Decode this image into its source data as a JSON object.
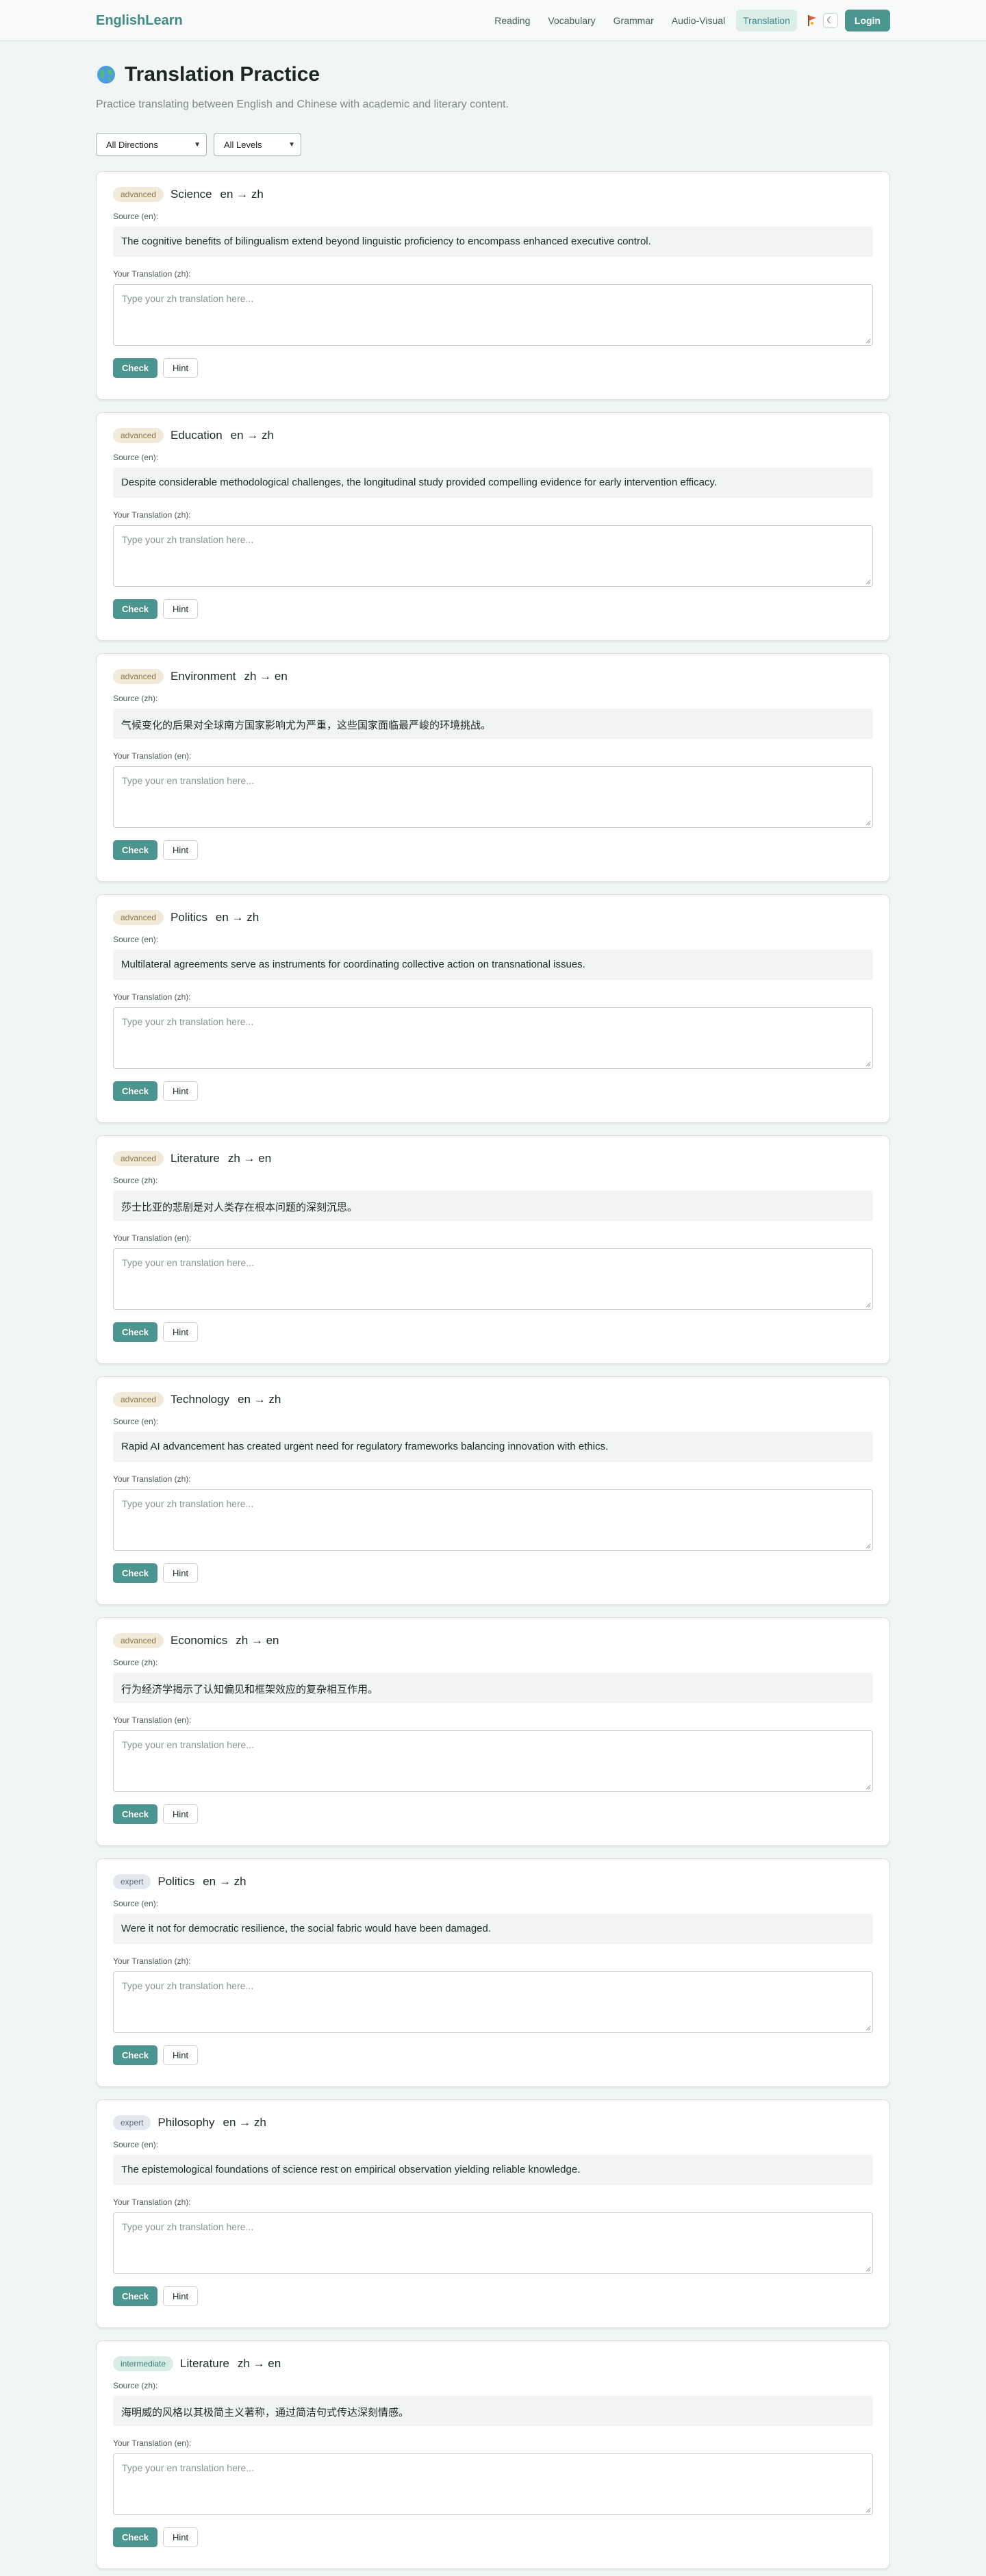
{
  "header": {
    "brand": "EnglishLearn",
    "nav": [
      "Reading",
      "Vocabulary",
      "Grammar",
      "Audio-Visual",
      "Translation"
    ],
    "active_nav": "Translation",
    "theme_icon": "moon-icon",
    "flag_icon": "flag-icon",
    "login": "Login",
    "accent_color": "#4a958e"
  },
  "page": {
    "title": "Translation Practice",
    "title_icon": "globe-icon",
    "subtitle": "Practice translating between English and Chinese with academic and literary content."
  },
  "filters": {
    "direction": "All Directions",
    "level": "All Levels"
  },
  "exercises": [
    {
      "level": "advanced",
      "topic": "Science",
      "direction": "en → zh",
      "source_label": "Source (en):",
      "source": "The cognitive benefits of bilingualism extend beyond linguistic proficiency to encompass enhanced executive control.",
      "answer_label": "Your Translation (zh):",
      "placeholder": "Type your zh translation here...",
      "check": "Check",
      "hint": "Hint"
    },
    {
      "level": "advanced",
      "topic": "Education",
      "direction": "en → zh",
      "source_label": "Source (en):",
      "source": "Despite considerable methodological challenges, the longitudinal study provided compelling evidence for early intervention efficacy.",
      "answer_label": "Your Translation (zh):",
      "placeholder": "Type your zh translation here...",
      "check": "Check",
      "hint": "Hint"
    },
    {
      "level": "advanced",
      "topic": "Environment",
      "direction": "zh → en",
      "source_label": "Source (zh):",
      "source": "气候变化的后果对全球南方国家影响尤为严重，这些国家面临最严峻的环境挑战。",
      "answer_label": "Your Translation (en):",
      "placeholder": "Type your en translation here...",
      "check": "Check",
      "hint": "Hint"
    },
    {
      "level": "advanced",
      "topic": "Politics",
      "direction": "en → zh",
      "source_label": "Source (en):",
      "source": "Multilateral agreements serve as instruments for coordinating collective action on transnational issues.",
      "answer_label": "Your Translation (zh):",
      "placeholder": "Type your zh translation here...",
      "check": "Check",
      "hint": "Hint"
    },
    {
      "level": "advanced",
      "topic": "Literature",
      "direction": "zh → en",
      "source_label": "Source (zh):",
      "source": "莎士比亚的悲剧是对人类存在根本问题的深刻沉思。",
      "answer_label": "Your Translation (en):",
      "placeholder": "Type your en translation here...",
      "check": "Check",
      "hint": "Hint"
    },
    {
      "level": "advanced",
      "topic": "Technology",
      "direction": "en → zh",
      "source_label": "Source (en):",
      "source": "Rapid AI advancement has created urgent need for regulatory frameworks balancing innovation with ethics.",
      "answer_label": "Your Translation (zh):",
      "placeholder": "Type your zh translation here...",
      "check": "Check",
      "hint": "Hint"
    },
    {
      "level": "advanced",
      "topic": "Economics",
      "direction": "zh → en",
      "source_label": "Source (zh):",
      "source": "行为经济学揭示了认知偏见和框架效应的复杂相互作用。",
      "answer_label": "Your Translation (en):",
      "placeholder": "Type your en translation here...",
      "check": "Check",
      "hint": "Hint"
    },
    {
      "level": "expert",
      "topic": "Politics",
      "direction": "en → zh",
      "source_label": "Source (en):",
      "source": "Were it not for democratic resilience, the social fabric would have been damaged.",
      "answer_label": "Your Translation (zh):",
      "placeholder": "Type your zh translation here...",
      "check": "Check",
      "hint": "Hint"
    },
    {
      "level": "expert",
      "topic": "Philosophy",
      "direction": "en → zh",
      "source_label": "Source (en):",
      "source": "The epistemological foundations of science rest on empirical observation yielding reliable knowledge.",
      "answer_label": "Your Translation (zh):",
      "placeholder": "Type your zh translation here...",
      "check": "Check",
      "hint": "Hint"
    },
    {
      "level": "intermediate",
      "topic": "Literature",
      "direction": "zh → en",
      "source_label": "Source (zh):",
      "source": "海明威的风格以其极简主义著称，通过简洁句式传达深刻情感。",
      "answer_label": "Your Translation (en):",
      "placeholder": "Type your en translation here...",
      "check": "Check",
      "hint": "Hint"
    }
  ]
}
